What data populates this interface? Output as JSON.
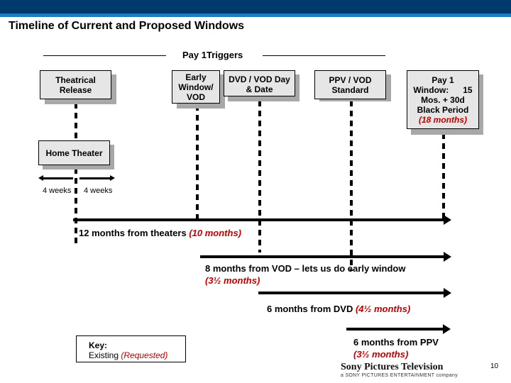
{
  "header": {
    "title": "Timeline of Current and Proposed Windows",
    "bar_color": "#003a6c",
    "stripe_color": "#1a7ec0"
  },
  "triggers_label": "Pay 1Triggers",
  "boxes": {
    "theatrical": [
      "Theatrical",
      "Release"
    ],
    "early": [
      "Early",
      "Window/",
      "VOD"
    ],
    "dvd": [
      "DVD / VOD Day",
      "& Date"
    ],
    "ppv": [
      "PPV / VOD",
      "Standard"
    ],
    "pay1": [
      "Pay 1",
      "Window:      15",
      "Mos. + 30d",
      "Black Period"
    ],
    "pay1_requested": "(18 months)",
    "home_theater": "Home Theater"
  },
  "weeks": {
    "left": "4 weeks",
    "right": "4 weeks"
  },
  "timelines": [
    {
      "existing": "12 months from theaters ",
      "requested": "(10 months)"
    },
    {
      "existing": "8 months from VOD – lets us do early window",
      "requested": "(3½  months)"
    },
    {
      "existing": "6 months from DVD ",
      "requested": "(4½  months)"
    },
    {
      "existing": "6 months from PPV",
      "requested": "(3½  months)"
    }
  ],
  "key": {
    "title": "Key:",
    "existing": "Existing ",
    "requested": "(Requested)"
  },
  "colors": {
    "requested": "#c00000",
    "box_fill": "#e6e6e6",
    "box_shadow": "#a8a8a8"
  },
  "footer": {
    "logo": "Sony Pictures Television",
    "logo_sub": "a SONY PICTURES ENTERTAINMENT company",
    "page_number": "10"
  }
}
